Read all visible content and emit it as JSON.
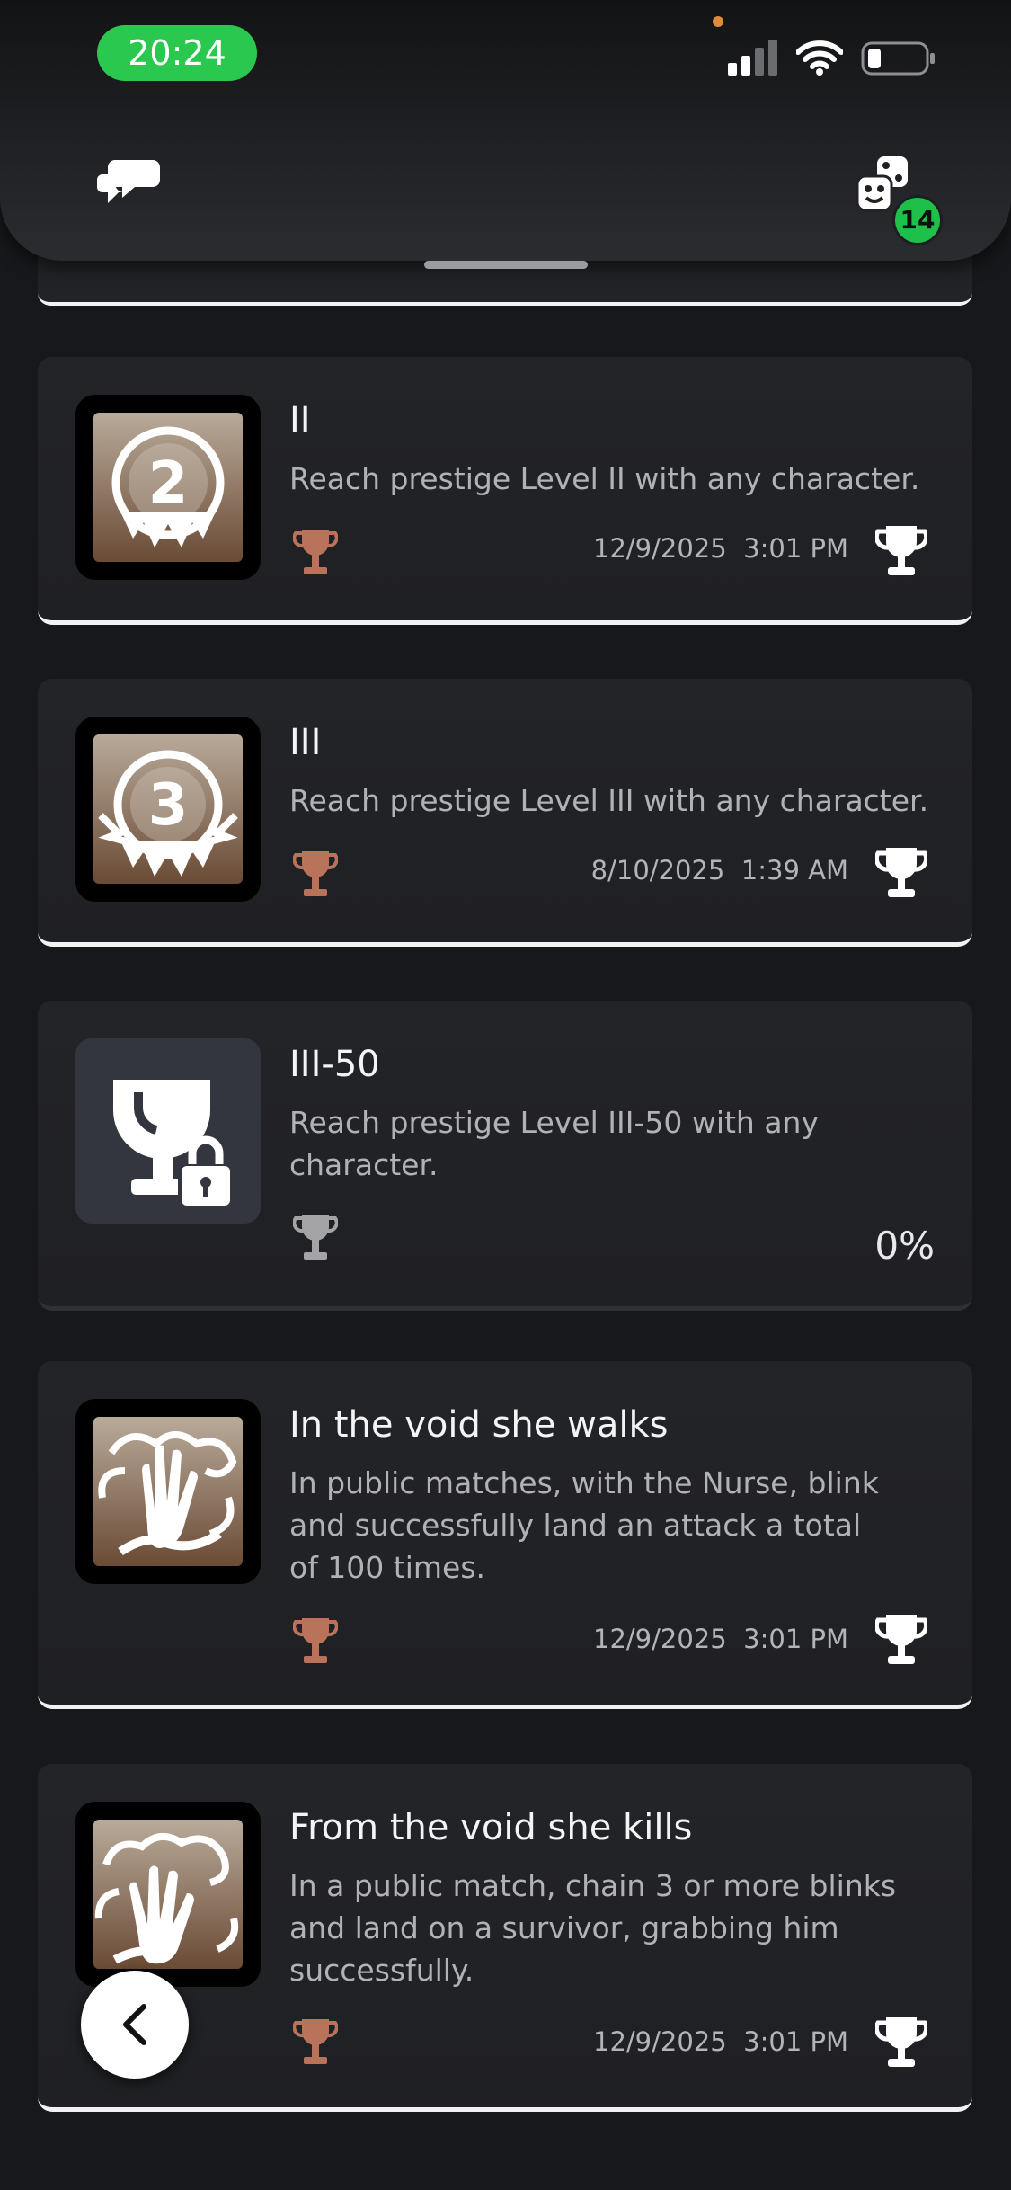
{
  "status_bar": {
    "time": "20:24"
  },
  "header": {
    "notification_count": "14"
  },
  "trophies": [
    {
      "title": "II",
      "description": "Reach prestige Level II with any character.",
      "grade": "bronze",
      "date": "12/9/2025",
      "time": "3:01 PM",
      "emblem": "2",
      "earned": true
    },
    {
      "title": "III",
      "description": "Reach prestige Level III with any character.",
      "grade": "bronze",
      "date": "8/10/2025",
      "time": "1:39 AM",
      "emblem": "3",
      "earned": true
    },
    {
      "title": "III-50",
      "description": "Reach prestige Level III-50 with any character.",
      "grade": "silver",
      "progress": "0%",
      "earned": false
    },
    {
      "title": "In the void she walks",
      "description": "In public matches, with the Nurse, blink and successfully land an attack a total of 100 times.",
      "grade": "bronze",
      "date": "12/9/2025",
      "time": "3:01 PM",
      "earned": true
    },
    {
      "title": "From the void she kills",
      "description": "In a public match, chain 3 or more blinks and land on a survivor, grabbing him successfully.",
      "grade": "bronze",
      "date": "12/9/2025",
      "time": "3:01 PM",
      "earned": true
    }
  ],
  "colors": {
    "bronze": "#b8735a",
    "silver": "#9a9a9a",
    "accent_green": "#2ac84e"
  },
  "icons": {
    "chat": "chat-bubbles-icon",
    "friends": "game-dice-icon",
    "back": "chevron-left-icon"
  }
}
